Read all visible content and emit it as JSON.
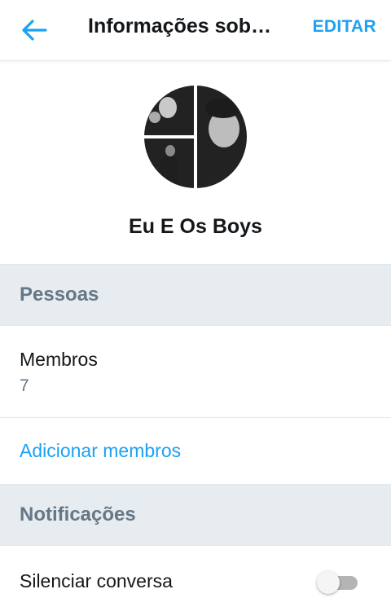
{
  "appbar": {
    "title": "Informações sob…",
    "edit_label": "EDITAR"
  },
  "group": {
    "name": "Eu E Os Boys"
  },
  "sections": {
    "people": "Pessoas",
    "notifications": "Notificações"
  },
  "members": {
    "label": "Membros",
    "count": "7",
    "add_label": "Adicionar membros"
  },
  "mute": {
    "label": "Silenciar conversa",
    "enabled": false
  },
  "colors": {
    "accent": "#1da1f2",
    "section_bg": "#e6ecf0",
    "section_text": "#657786"
  },
  "icons": {
    "back": "arrow-left-icon"
  }
}
